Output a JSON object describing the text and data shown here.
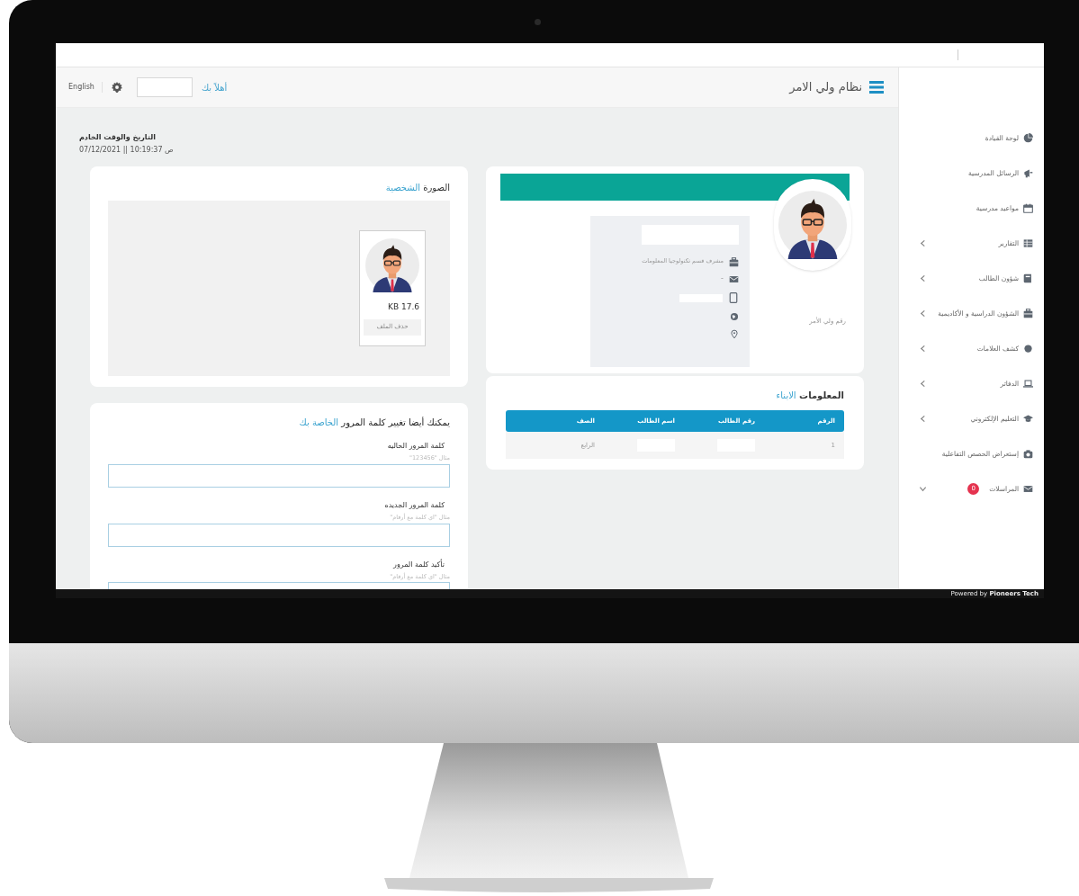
{
  "screen": {
    "header": {
      "title": "نظام ولي الامر",
      "greeting": "أهلاً بك",
      "language": "English"
    },
    "server_time": {
      "label": "التاريخ والوقت الخادم",
      "value": "07/12/2021 || 10:19:37 ص"
    },
    "profile_photo": {
      "title": "الصورة",
      "title_accent": "الشخصية",
      "file_size": "KB 17.6",
      "delete_button": {
        "label": "حذف الملف",
        "disabled": true
      }
    },
    "password": {
      "title": "يمكنك أيضا تغيير كلمة المرور",
      "title_accent": "الخاصة بك",
      "fields": [
        {
          "label": "كلمة المرور الحاليه",
          "hint": "مثال \"123456\""
        },
        {
          "label": "كلمة المرور الجديده",
          "hint": "مثال \"اي كلمة مع أرقام\""
        },
        {
          "label": "تأكيد كلمة المرور",
          "hint": "مثال \"اي كلمة مع أرقام\""
        }
      ]
    },
    "profile": {
      "job": "مشرف قسم تكنولوجيا المعلومات",
      "email": "-",
      "parent_number_label": "رقم ولي الأمر"
    },
    "children_info": {
      "title": "المعلومات",
      "title_accent": "الابناء",
      "columns": [
        "الرقم",
        "رقم الطالب",
        "اسم الطالب",
        "الصف"
      ],
      "rows": [
        {
          "cells": [
            {
              "kind": "text",
              "text": "1"
            },
            {
              "kind": "redacted"
            },
            {
              "kind": "redacted"
            },
            {
              "kind": "text",
              "text": "الرابع"
            }
          ]
        }
      ]
    },
    "sidebar": {
      "items": [
        {
          "label": "لوحة القيادة",
          "submenu": false
        },
        {
          "label": "الرسائل المدرسية",
          "submenu": false
        },
        {
          "label": "مواعيد مدرسية",
          "submenu": false
        },
        {
          "label": "التقارير",
          "submenu": true,
          "expanded": false
        },
        {
          "label": "شؤون الطالب",
          "submenu": true,
          "expanded": false
        },
        {
          "label": "الشؤون الدراسية و الأكاديمية",
          "submenu": true,
          "expanded": false
        },
        {
          "label": "كشف العلامات",
          "submenu": true,
          "expanded": false
        },
        {
          "label": "الدفاتر",
          "submenu": true,
          "expanded": false
        },
        {
          "label": "التعليم الإلكتروني",
          "submenu": true,
          "expanded": false
        },
        {
          "label": "إستعراض الحصص التفاعلية",
          "submenu": false
        },
        {
          "label": "المراسلات",
          "submenu": true,
          "expanded": true,
          "badge": "0"
        }
      ]
    },
    "footer": "Powered by **Pioneers Tech**"
  }
}
